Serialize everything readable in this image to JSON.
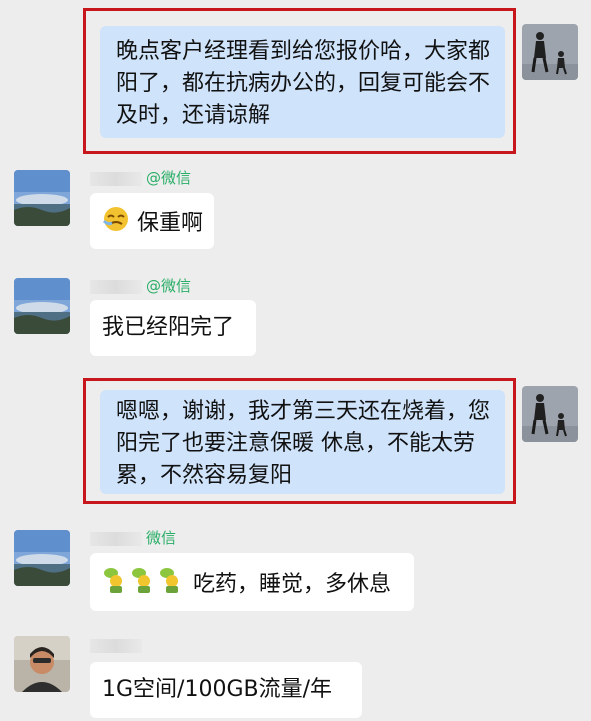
{
  "messages": [
    {
      "side": "out",
      "text": "晚点客户经理看到给您报价哈，大家都阳了，都在抗病办公的，回复可能会不及时，还请谅解"
    },
    {
      "side": "in",
      "sender": "@微信",
      "emoji": "face-emoji",
      "text": "保重啊"
    },
    {
      "side": "in",
      "sender": "@微信",
      "text": "我已经阳完了"
    },
    {
      "side": "out",
      "text": "嗯嗯，谢谢，我才第三天还在烧着，您阳完了也要注意保暖 休息，不能太劳累，不然容易复阳"
    },
    {
      "side": "in",
      "sender": "微信",
      "emoji": "plant-emoji-x3",
      "text": "吃药，睡觉，多休息"
    },
    {
      "side": "in",
      "sender": "",
      "text": "1G空间/100GB流量/年"
    }
  ],
  "colors": {
    "background": "#ededed",
    "outgoing_bubble": "#cfe3fb",
    "incoming_bubble": "#ffffff",
    "highlight_box": "#c8161d",
    "sender_label": "#2aae67"
  }
}
